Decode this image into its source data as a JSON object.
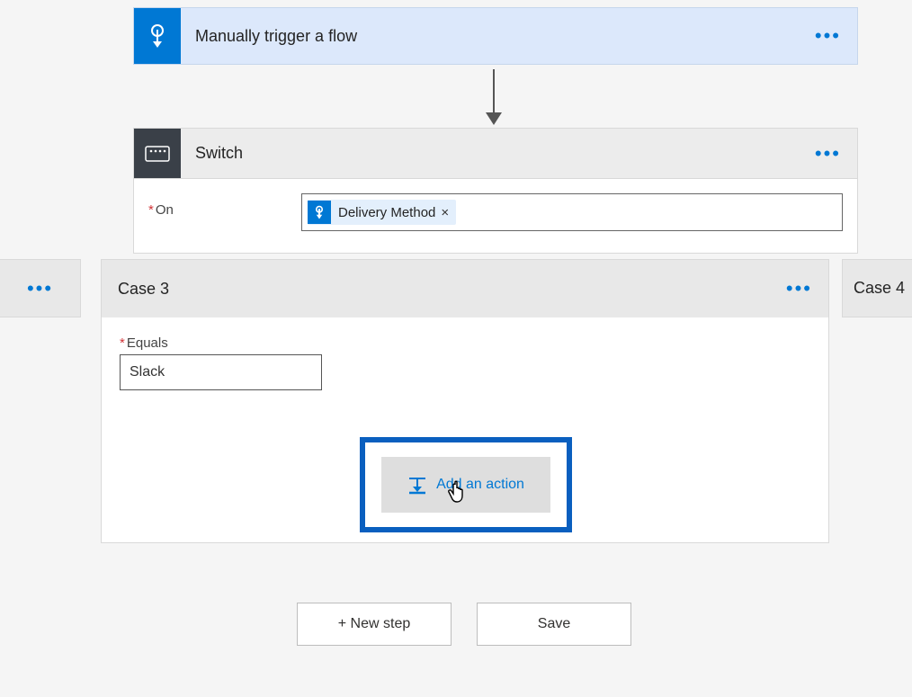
{
  "trigger": {
    "title": "Manually trigger a flow"
  },
  "switch": {
    "title": "Switch",
    "on_label": "On",
    "token": {
      "label": "Delivery Method",
      "remove": "×"
    }
  },
  "case_left": {
    "title": ""
  },
  "case_right": {
    "title": "Case 4"
  },
  "case3": {
    "title": "Case 3",
    "equals_label": "Equals",
    "equals_value": "Slack",
    "add_action": "Add an action"
  },
  "buttons": {
    "new_step": "+ New step",
    "save": "Save"
  },
  "colors": {
    "primary": "#0078d4",
    "highlight_border": "#0a5fbf"
  }
}
